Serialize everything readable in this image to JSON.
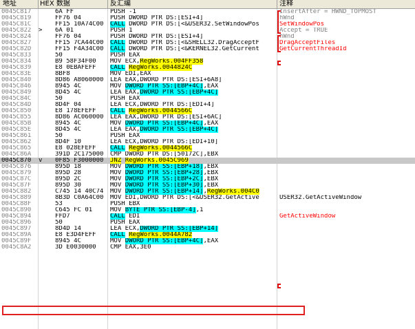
{
  "header": {
    "address": "地址",
    "hex": "HEX 数据",
    "disasm": "反汇编",
    "comment": "注释"
  },
  "rows": [
    {
      "addr": "0045C817",
      "mark": "",
      "hex": "6A FF",
      "asm": [
        {
          "t": "PUSH -1"
        }
      ],
      "cmt": [
        {
          "t": "InsertAfter = HWND_TOPMOST",
          "s": "gray"
        }
      ]
    },
    {
      "addr": "0045C819",
      "mark": "",
      "hex": "FF76 04",
      "asm": [
        {
          "t": "PUSH DWORD PTR DS:[ESI+4]"
        }
      ],
      "cmt": [
        {
          "t": "hWnd",
          "s": "gray"
        }
      ]
    },
    {
      "addr": "0045C81C",
      "mark": "",
      "hex": "FF15 10A74C00",
      "asm": [
        {
          "t": "CALL",
          "s": "cyan"
        },
        {
          "t": " DWORD PTR DS:[<&USER32.SetWindowPos"
        }
      ],
      "cmt": [
        {
          "t": "SetWindowPos",
          "s": "red"
        }
      ]
    },
    {
      "addr": "0045C822",
      "mark": ">",
      "hex": "6A 01",
      "asm": [
        {
          "t": "PUSH 1"
        }
      ],
      "cmt": [
        {
          "t": "Accept = TRUE",
          "s": "gray"
        }
      ]
    },
    {
      "addr": "0045C824",
      "mark": "",
      "hex": "FF76 04",
      "asm": [
        {
          "t": "PUSH DWORD PTR DS:[ESI+4]"
        }
      ],
      "cmt": [
        {
          "t": "hWnd",
          "s": "gray"
        }
      ]
    },
    {
      "addr": "0045C827",
      "mark": "",
      "hex": "FF15 7CA44C00",
      "asm": [
        {
          "t": "CALL",
          "s": "cyan"
        },
        {
          "t": " DWORD PTR DS:[<&SHELL32.DragAcceptF"
        }
      ],
      "cmt": [
        {
          "t": "DragAcceptFiles",
          "s": "red"
        }
      ]
    },
    {
      "addr": "0045C82D",
      "mark": "",
      "hex": "FF15 F4A34C00",
      "asm": [
        {
          "t": "CALL",
          "s": "cyan"
        },
        {
          "t": " DWORD PTR DS:[<&KERNEL32.GetCurrent"
        }
      ],
      "cmt": [
        {
          "t": "GetCurrentThreadId",
          "s": "red"
        }
      ]
    },
    {
      "addr": "0045C833",
      "mark": "",
      "hex": "50",
      "asm": [
        {
          "t": "PUSH EAX"
        }
      ],
      "cmt": []
    },
    {
      "addr": "0045C834",
      "mark": "",
      "hex": "B9 58F34F00",
      "asm": [
        {
          "t": "MOV ECX,"
        },
        {
          "t": "RegWorks.004FF358",
          "s": "yellow"
        }
      ],
      "cmt": []
    },
    {
      "addr": "0045C839",
      "mark": "",
      "hex": "E8 0EBAFEFF",
      "asm": [
        {
          "t": "CALL",
          "s": "cyan"
        },
        {
          "t": " "
        },
        {
          "t": "RegWorks.0044824C",
          "s": "yellow"
        }
      ],
      "cmt": []
    },
    {
      "addr": "0045C83E",
      "mark": "",
      "hex": "8BF8",
      "asm": [
        {
          "t": "MOV EDI,EAX"
        }
      ],
      "cmt": []
    },
    {
      "addr": "0045C840",
      "mark": "",
      "hex": "8D86 A8060000",
      "asm": [
        {
          "t": "LEA EAX,DWORD PTR DS:[ESI+6A8]"
        }
      ],
      "cmt": []
    },
    {
      "addr": "0045C846",
      "mark": "",
      "hex": "8945 4C",
      "asm": [
        {
          "t": "MOV "
        },
        {
          "t": "DWORD PTR SS:[EBP+4C]",
          "s": "cyan"
        },
        {
          "t": ",EAX"
        }
      ],
      "cmt": []
    },
    {
      "addr": "0045C849",
      "mark": "",
      "hex": "8D45 4C",
      "asm": [
        {
          "t": "LEA EAX,"
        },
        {
          "t": "DWORD PTR SS:[EBP+4C]",
          "s": "cyan"
        }
      ],
      "cmt": []
    },
    {
      "addr": "0045C84C",
      "mark": "",
      "hex": "50",
      "asm": [
        {
          "t": "PUSH EAX"
        }
      ],
      "cmt": []
    },
    {
      "addr": "0045C84D",
      "mark": "",
      "hex": "8D4F 04",
      "asm": [
        {
          "t": "LEA ECX,DWORD PTR DS:[EDI+4]"
        }
      ],
      "cmt": []
    },
    {
      "addr": "0045C850",
      "mark": "",
      "hex": "E8 178EFEFF",
      "asm": [
        {
          "t": "CALL",
          "s": "cyan"
        },
        {
          "t": " "
        },
        {
          "t": "RegWorks.0044566C",
          "s": "yellow"
        }
      ],
      "cmt": []
    },
    {
      "addr": "0045C855",
      "mark": "",
      "hex": "8D86 AC060000",
      "asm": [
        {
          "t": "LEA EAX,DWORD PTR DS:[ESI+6AC]"
        }
      ],
      "cmt": []
    },
    {
      "addr": "0045C85B",
      "mark": "",
      "hex": "8945 4C",
      "asm": [
        {
          "t": "MOV "
        },
        {
          "t": "DWORD PTR SS:[EBP+4C]",
          "s": "cyan"
        },
        {
          "t": ",EAX"
        }
      ],
      "cmt": []
    },
    {
      "addr": "0045C85E",
      "mark": "",
      "hex": "8D45 4C",
      "asm": [
        {
          "t": "LEA EAX,"
        },
        {
          "t": "DWORD PTR SS:[EBP+4C]",
          "s": "cyan"
        }
      ],
      "cmt": []
    },
    {
      "addr": "0045C861",
      "mark": "",
      "hex": "50",
      "asm": [
        {
          "t": "PUSH EAX"
        }
      ],
      "cmt": []
    },
    {
      "addr": "0045C862",
      "mark": "",
      "hex": "8D4F 10",
      "asm": [
        {
          "t": "LEA ECX,DWORD PTR DS:[EDI+10]"
        }
      ],
      "cmt": []
    },
    {
      "addr": "0045C865",
      "mark": "",
      "hex": "E8 028EFEFF",
      "asm": [
        {
          "t": "CALL",
          "s": "cyan"
        },
        {
          "t": " "
        },
        {
          "t": "RegWorks.0044566C",
          "s": "yellow"
        }
      ],
      "cmt": []
    },
    {
      "addr": "0045C86A",
      "mark": "",
      "hex": "391D 2C175000",
      "asm": [
        {
          "t": "CMP DWORD PTR DS:[50172C],EBX"
        }
      ],
      "cmt": []
    },
    {
      "addr": "0045C870",
      "mark": "v",
      "hex": "0F85 F3000000",
      "asm": [
        {
          "t": "JNZ",
          "s": "yellow"
        },
        {
          "t": " "
        },
        {
          "t": "RegWorks.0045C969",
          "s": "yellow"
        }
      ],
      "cmt": [],
      "sel": true
    },
    {
      "addr": "0045C876",
      "mark": "",
      "hex": "895D 18",
      "asm": [
        {
          "t": "MOV "
        },
        {
          "t": "DWORD PTR SS:[EBP+18]",
          "s": "cyan"
        },
        {
          "t": ",EBX"
        }
      ],
      "cmt": []
    },
    {
      "addr": "0045C879",
      "mark": "",
      "hex": "895D 28",
      "asm": [
        {
          "t": "MOV "
        },
        {
          "t": "DWORD PTR SS:[EBP+28]",
          "s": "cyan"
        },
        {
          "t": ",EBX"
        }
      ],
      "cmt": []
    },
    {
      "addr": "0045C87C",
      "mark": "",
      "hex": "895D 2C",
      "asm": [
        {
          "t": "MOV "
        },
        {
          "t": "DWORD PTR SS:[EBP+2C]",
          "s": "cyan"
        },
        {
          "t": ",EBX"
        }
      ],
      "cmt": []
    },
    {
      "addr": "0045C87F",
      "mark": "",
      "hex": "895D 30",
      "asm": [
        {
          "t": "MOV "
        },
        {
          "t": "DWORD PTR SS:[EBP+30]",
          "s": "cyan"
        },
        {
          "t": ",EBX"
        }
      ],
      "cmt": []
    },
    {
      "addr": "0045C882",
      "mark": "",
      "hex": "C745 14 40C74",
      "asm": [
        {
          "t": "MOV "
        },
        {
          "t": "DWORD PTR SS:[EBP+14]",
          "s": "cyan"
        },
        {
          "t": ","
        },
        {
          "t": "RegWorks.004C0",
          "s": "yellow"
        }
      ],
      "cmt": []
    },
    {
      "addr": "0045C889",
      "mark": "",
      "hex": "8B3D C0A64C00",
      "asm": [
        {
          "t": "MOV EDI,DWORD PTR DS:[<&USER32.GetActive"
        }
      ],
      "cmt": [
        {
          "t": "USER32.GetActiveWindow"
        }
      ]
    },
    {
      "addr": "0045C88F",
      "mark": "",
      "hex": "53",
      "asm": [
        {
          "t": "PUSH EBX"
        }
      ],
      "cmt": []
    },
    {
      "addr": "0045C890",
      "mark": "",
      "hex": "C645 FC 01",
      "asm": [
        {
          "t": "MOV "
        },
        {
          "t": "BYTE PTR SS:[EBP-4]",
          "s": "cyan"
        },
        {
          "t": ",1"
        }
      ],
      "cmt": []
    },
    {
      "addr": "0045C894",
      "mark": "",
      "hex": "FFD7",
      "asm": [
        {
          "t": "CALL",
          "s": "cyan"
        },
        {
          "t": " EDI"
        }
      ],
      "cmt": [
        {
          "t": "GetActiveWindow",
          "s": "red"
        }
      ]
    },
    {
      "addr": "0045C896",
      "mark": "",
      "hex": "50",
      "asm": [
        {
          "t": "PUSH EAX"
        }
      ],
      "cmt": []
    },
    {
      "addr": "0045C897",
      "mark": "",
      "hex": "8D4D 14",
      "asm": [
        {
          "t": "LEA ECX,"
        },
        {
          "t": "DWORD PTR SS:[EBP+14]",
          "s": "cyan"
        }
      ],
      "cmt": []
    },
    {
      "addr": "0045C89A",
      "mark": "",
      "hex": "E8 E3D4FEFF",
      "asm": [
        {
          "t": "CALL",
          "s": "cyan"
        },
        {
          "t": " "
        },
        {
          "t": "RegWorks.0044A782",
          "s": "yellow"
        }
      ],
      "cmt": []
    },
    {
      "addr": "0045C89F",
      "mark": "",
      "hex": "8945 4C",
      "asm": [
        {
          "t": "MOV "
        },
        {
          "t": "DWORD PTR SS:[EBP+4C]",
          "s": "cyan"
        },
        {
          "t": ",EAX"
        }
      ],
      "cmt": []
    },
    {
      "addr": "0045C8A2",
      "mark": "",
      "hex": "3D E0030000",
      "asm": [
        {
          "t": "CMP EAX,3E0"
        }
      ],
      "cmt": []
    }
  ]
}
